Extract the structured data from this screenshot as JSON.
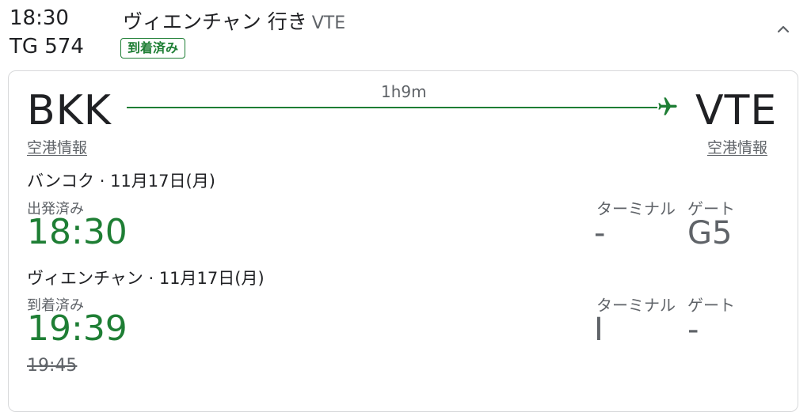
{
  "header": {
    "departure_time": "18:30",
    "flight_number": "TG 574",
    "destination_label": "ヴィエンチャン 行き",
    "destination_code": "VTE",
    "status_badge": "到着済み"
  },
  "route": {
    "origin_code": "BKK",
    "destination_code": "VTE",
    "duration": "1h9m",
    "airport_info_link": "空港情報",
    "accent_color": "#1e7e34"
  },
  "departure": {
    "city_date": "バンコク · 11月17日(月)",
    "status": "出発済み",
    "time": "18:30",
    "terminal_label": "ターミナル",
    "terminal": "-",
    "gate_label": "ゲート",
    "gate": "G5"
  },
  "arrival": {
    "city_date": "ヴィエンチャン · 11月17日(月)",
    "status": "到着済み",
    "time": "19:39",
    "scheduled_time": "19:45",
    "terminal_label": "ターミナル",
    "terminal": "I",
    "gate_label": "ゲート",
    "gate": "-"
  },
  "icons": [
    "chevron-up-icon",
    "airplane-icon"
  ]
}
